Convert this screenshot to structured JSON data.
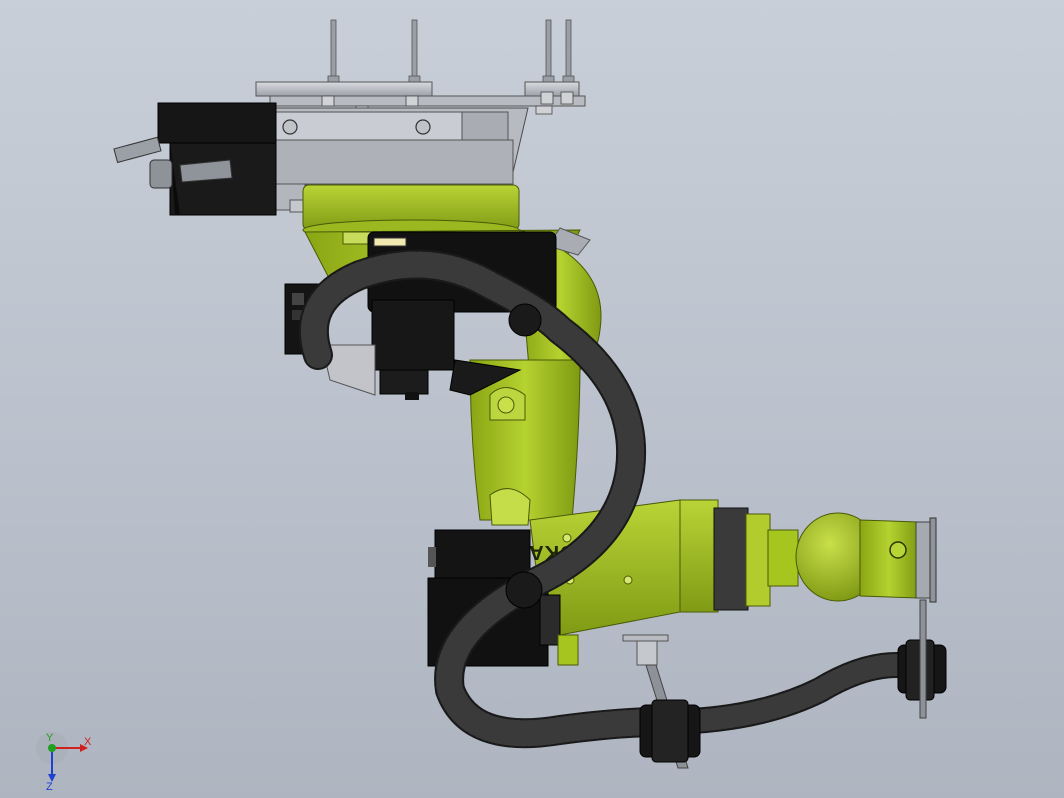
{
  "viewport": {
    "background_top": "#c9cfd8",
    "background_bottom": "#aeb5c0"
  },
  "model": {
    "brand_text": "KUKA",
    "colors": {
      "robot_body": "#a6c51e",
      "robot_body_shade": "#7f9a12",
      "cable": "#1e1e1e",
      "bracket": "#c8c8cc",
      "motor": "#111111"
    },
    "icons": [
      "robot-arm-model",
      "cable-harness",
      "mounting-plate",
      "servo-motor"
    ]
  },
  "triad": {
    "x_label": "X",
    "y_label": "Y",
    "z_label": "Z",
    "x_color": "#d02020",
    "y_color": "#20a020",
    "z_color": "#2040d0"
  }
}
